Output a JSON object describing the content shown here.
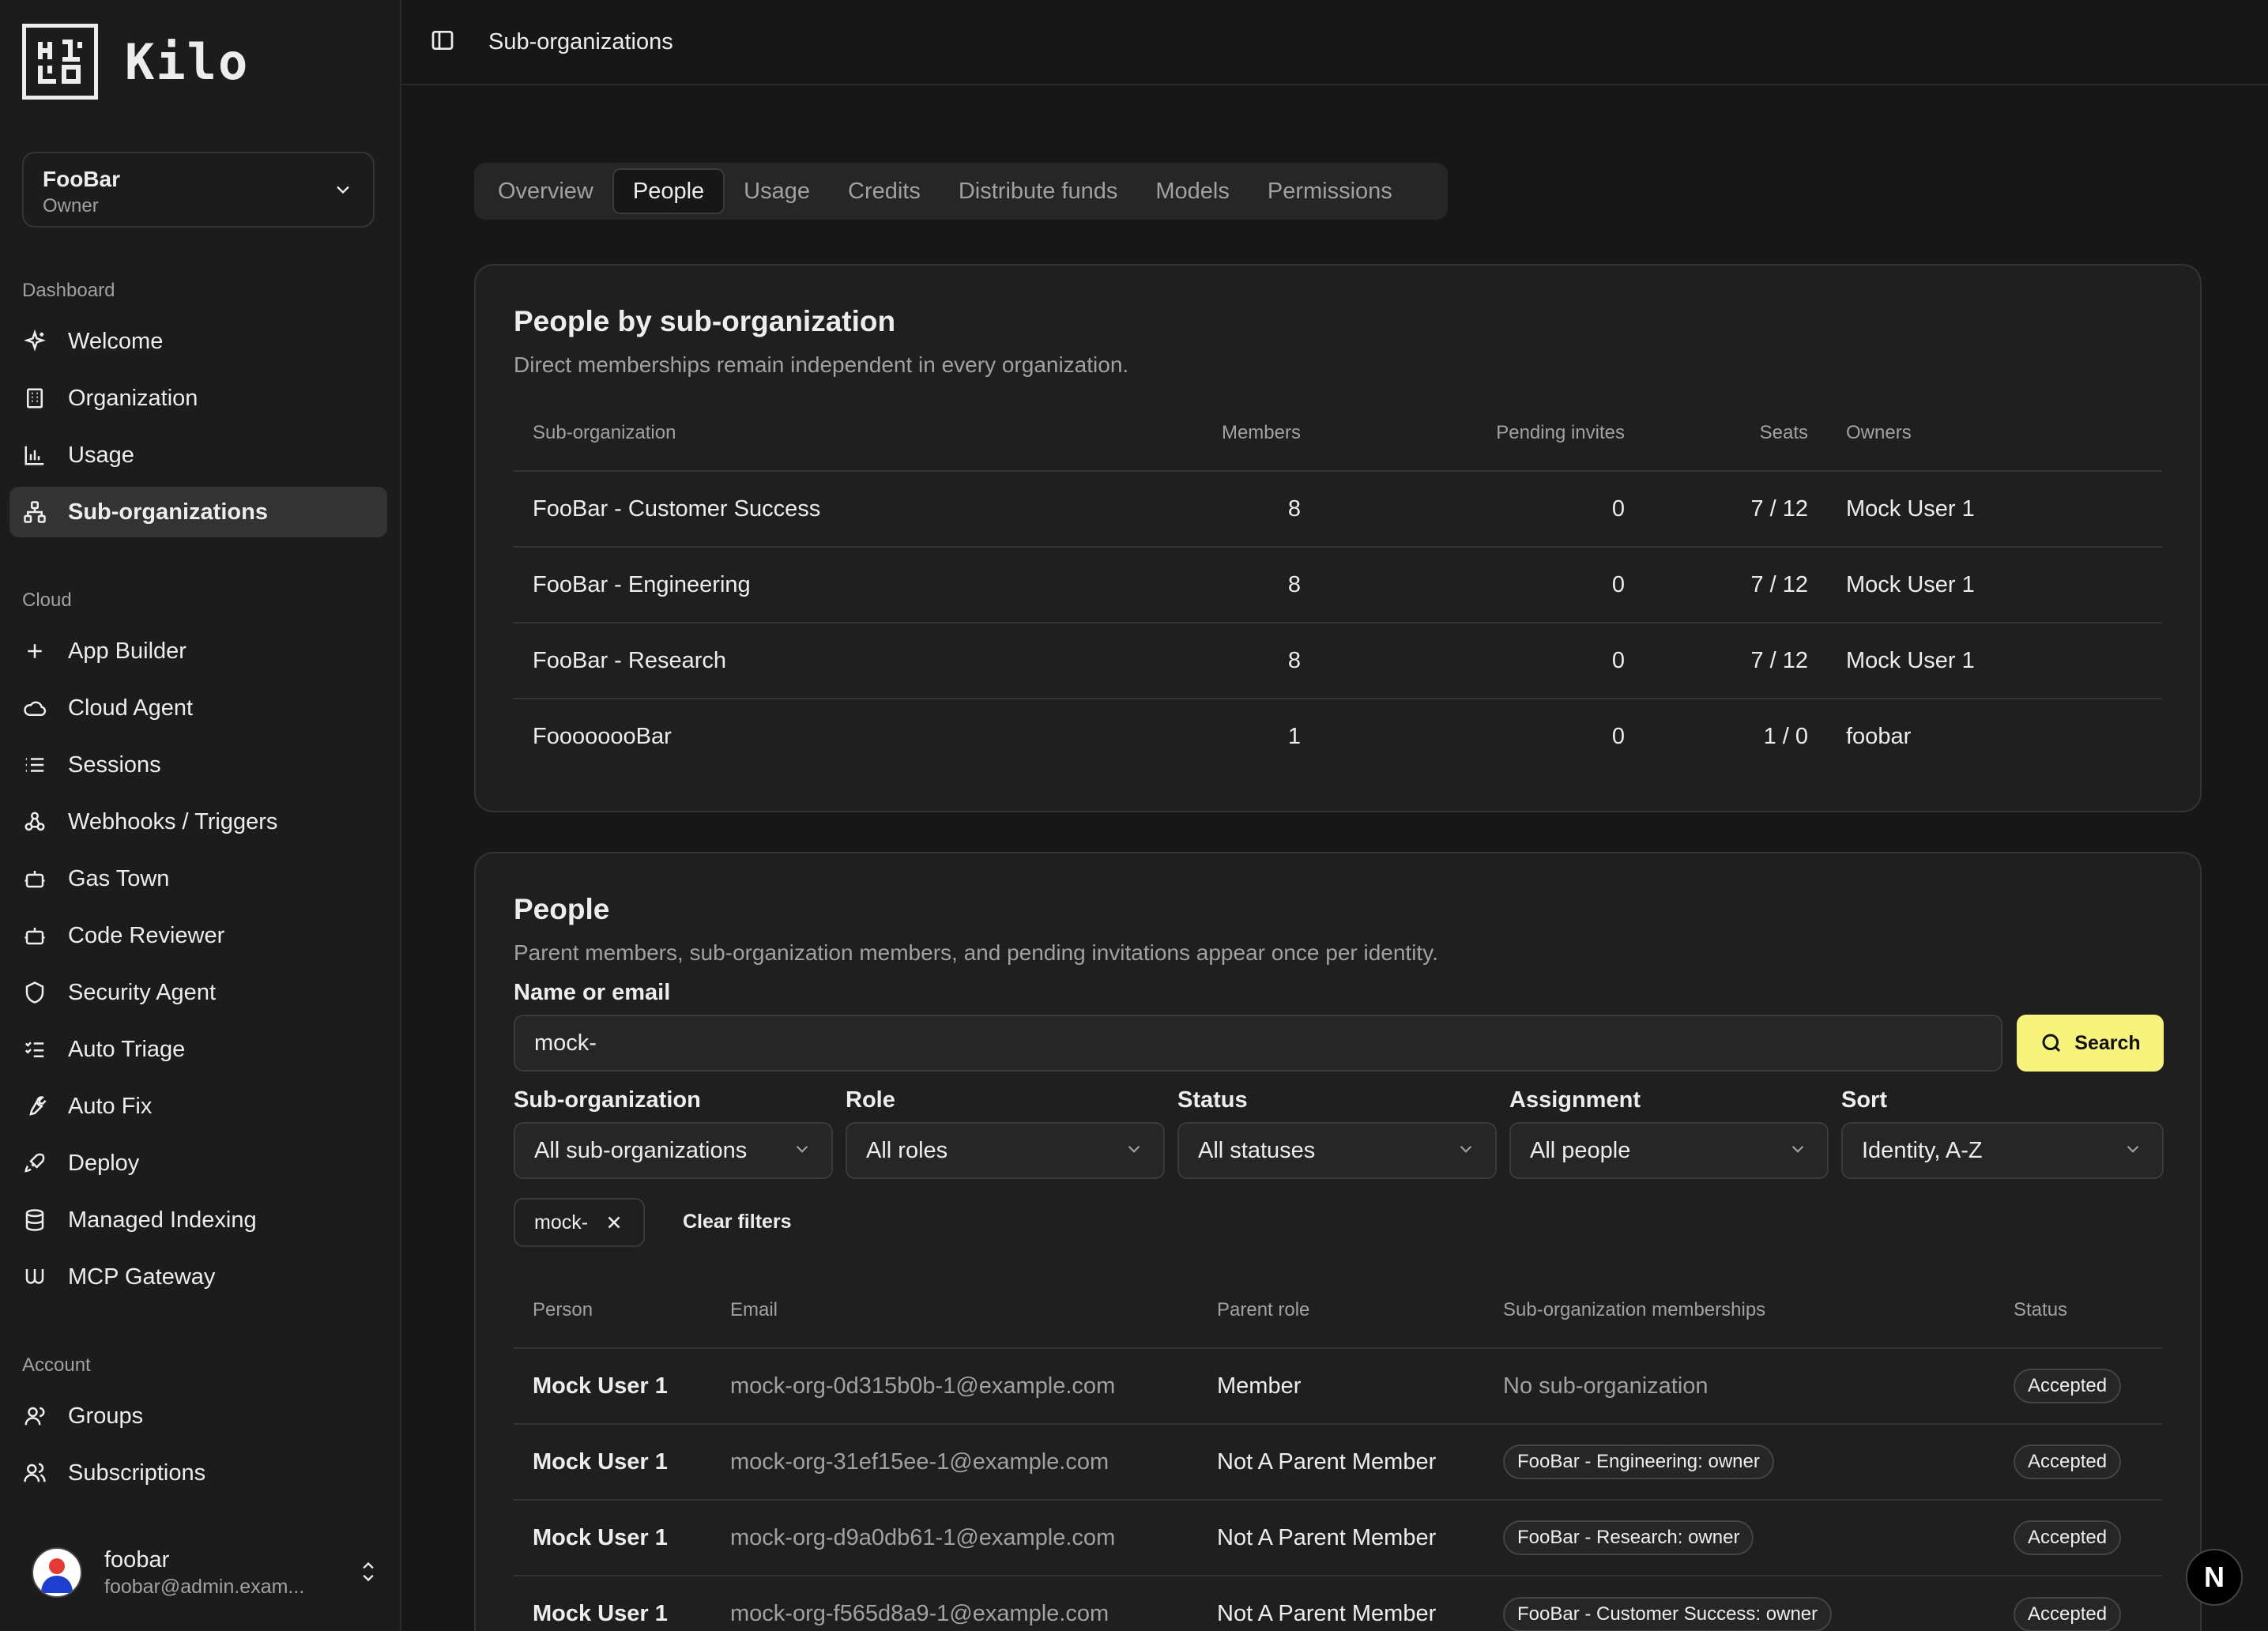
{
  "app": {
    "logo_text": "Kilo"
  },
  "org_switcher": {
    "name": "FooBar",
    "role": "Owner"
  },
  "sidebar": {
    "sections": {
      "dashboard": "Dashboard",
      "cloud": "Cloud",
      "account": "Account"
    },
    "dashboard_items": [
      {
        "label": "Welcome",
        "icon": "sparkles-icon"
      },
      {
        "label": "Organization",
        "icon": "building-icon"
      },
      {
        "label": "Usage",
        "icon": "bar-chart-icon"
      },
      {
        "label": "Sub-organizations",
        "icon": "network-icon",
        "active": true
      }
    ],
    "cloud_items": [
      {
        "label": "App Builder",
        "icon": "plus-icon"
      },
      {
        "label": "Cloud Agent",
        "icon": "cloud-icon"
      },
      {
        "label": "Sessions",
        "icon": "list-icon"
      },
      {
        "label": "Webhooks / Triggers",
        "icon": "webhook-icon"
      },
      {
        "label": "Gas Town",
        "icon": "bot-icon"
      },
      {
        "label": "Code Reviewer",
        "icon": "bot-icon"
      },
      {
        "label": "Security Agent",
        "icon": "shield-icon"
      },
      {
        "label": "Auto Triage",
        "icon": "list-checks-icon"
      },
      {
        "label": "Auto Fix",
        "icon": "wrench-icon"
      },
      {
        "label": "Deploy",
        "icon": "rocket-icon"
      },
      {
        "label": "Managed Indexing",
        "icon": "database-icon"
      },
      {
        "label": "MCP Gateway",
        "icon": "mcp-icon"
      }
    ],
    "account_items": [
      {
        "label": "Groups",
        "icon": "user-icon"
      },
      {
        "label": "Subscriptions",
        "icon": "users-icon"
      }
    ],
    "user": {
      "name": "foobar",
      "email": "foobar@admin.exam..."
    }
  },
  "header": {
    "title": "Sub-organizations"
  },
  "tabs": [
    "Overview",
    "People",
    "Usage",
    "Credits",
    "Distribute funds",
    "Models",
    "Permissions"
  ],
  "active_tab": "People",
  "suborg_card": {
    "title": "People by sub-organization",
    "description": "Direct memberships remain independent in every organization.",
    "columns": [
      "Sub-organization",
      "Members",
      "Pending invites",
      "Seats",
      "Owners"
    ],
    "rows": [
      [
        "FooBar - Customer Success",
        "8",
        "0",
        "7 / 12",
        "Mock User 1"
      ],
      [
        "FooBar - Engineering",
        "8",
        "0",
        "7 / 12",
        "Mock User 1"
      ],
      [
        "FooBar - Research",
        "8",
        "0",
        "7 / 12",
        "Mock User 1"
      ],
      [
        "FoooooooBar",
        "1",
        "0",
        "1 / 0",
        "foobar"
      ]
    ]
  },
  "people_card": {
    "title": "People",
    "description": "Parent members, sub-organization members, and pending invitations appear once per identity.",
    "search": {
      "label": "Name or email",
      "value": "mock-",
      "button": "Search"
    },
    "filters": [
      {
        "label": "Sub-organization",
        "value": "All sub-organizations"
      },
      {
        "label": "Role",
        "value": "All roles"
      },
      {
        "label": "Status",
        "value": "All statuses"
      },
      {
        "label": "Assignment",
        "value": "All people"
      },
      {
        "label": "Sort",
        "value": "Identity, A-Z"
      }
    ],
    "active_chip": "mock-",
    "clear_filters": "Clear filters",
    "columns": [
      "Person",
      "Email",
      "Parent role",
      "Sub-organization memberships",
      "Status"
    ],
    "rows": [
      {
        "person": "Mock User 1",
        "email": "mock-org-0d315b0b-1@example.com",
        "role": "Member",
        "membership": "No sub-organization",
        "membership_is_pill": false,
        "status": "Accepted"
      },
      {
        "person": "Mock User 1",
        "email": "mock-org-31ef15ee-1@example.com",
        "role": "Not A Parent Member",
        "membership": "FooBar - Engineering: owner",
        "membership_is_pill": true,
        "status": "Accepted"
      },
      {
        "person": "Mock User 1",
        "email": "mock-org-d9a0db61-1@example.com",
        "role": "Not A Parent Member",
        "membership": "FooBar - Research: owner",
        "membership_is_pill": true,
        "status": "Accepted"
      },
      {
        "person": "Mock User 1",
        "email": "mock-org-f565d8a9-1@example.com",
        "role": "Not A Parent Member",
        "membership": "FooBar - Customer Success: owner",
        "membership_is_pill": true,
        "status": "Accepted"
      }
    ]
  },
  "colors": {
    "accent_yellow": "#f8f37a",
    "background": "#171717",
    "sidebar": "#1c1c1c"
  }
}
